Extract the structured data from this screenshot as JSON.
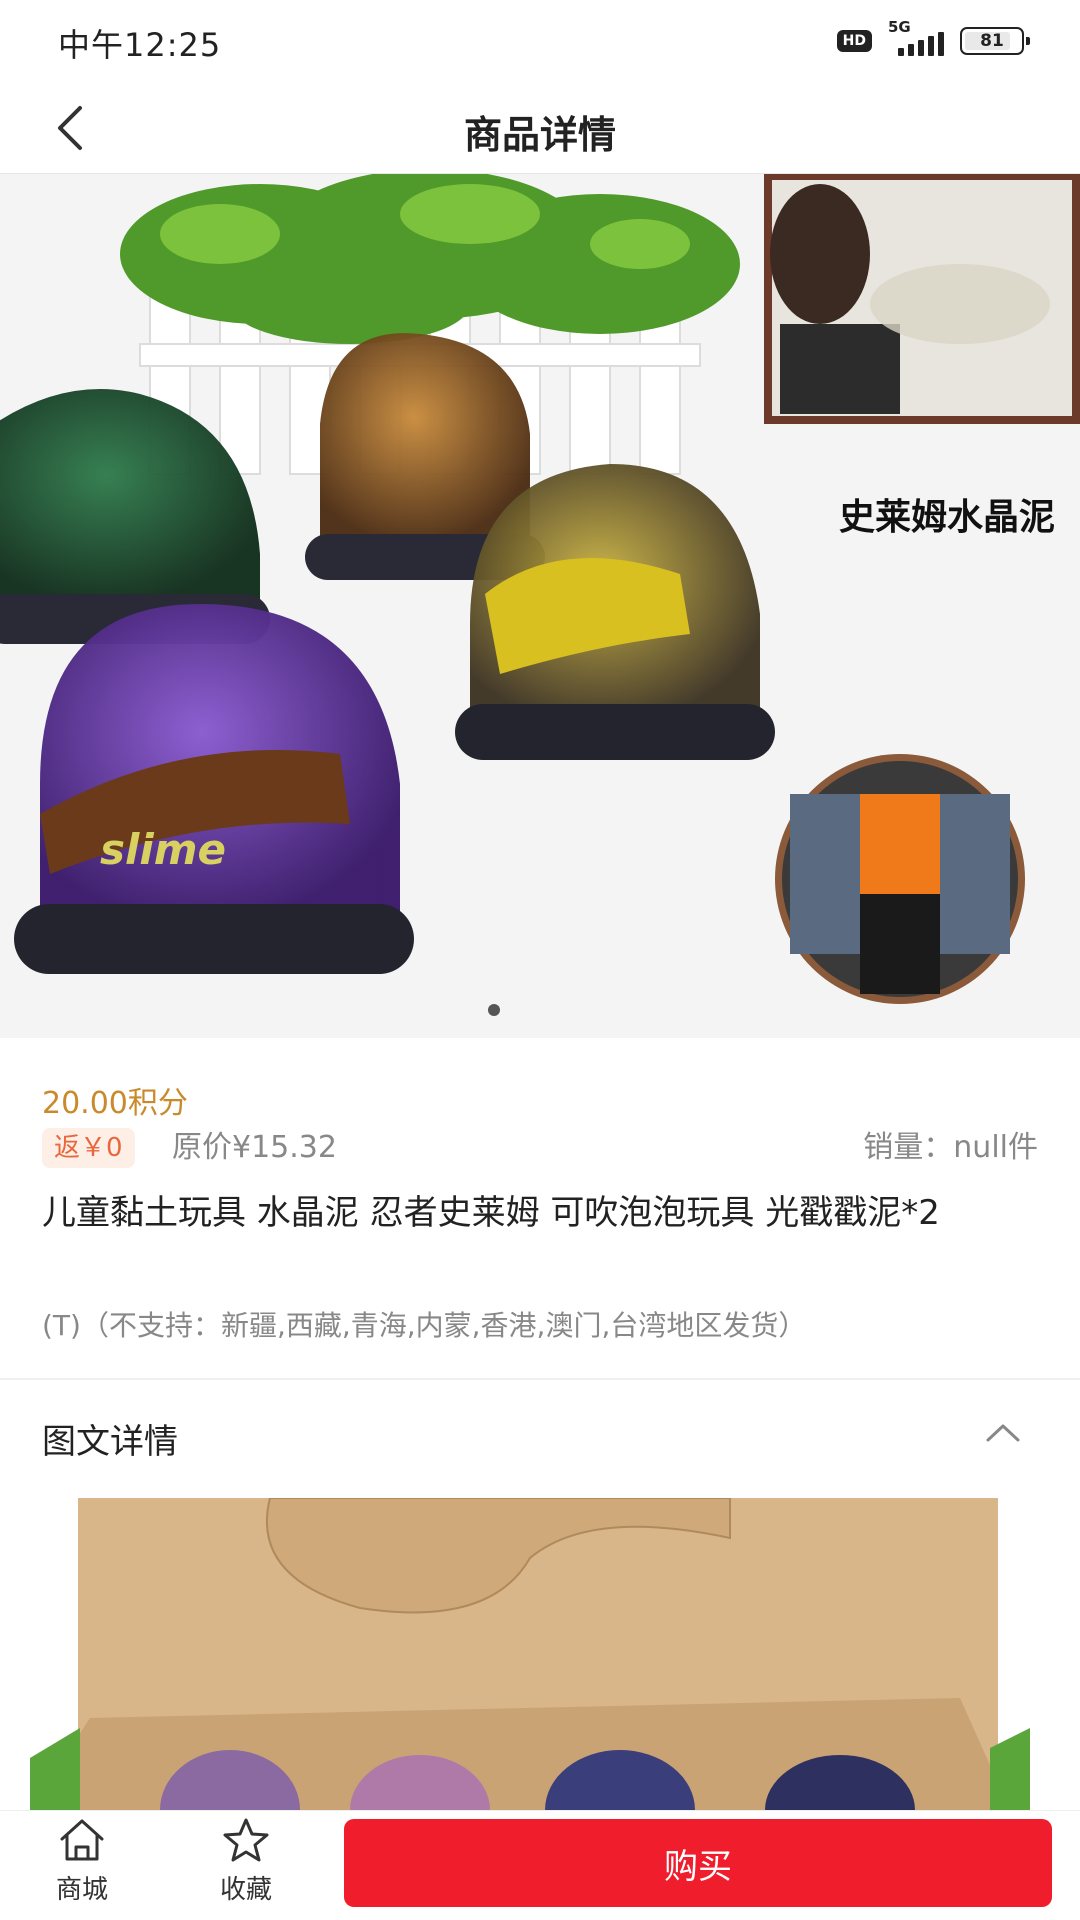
{
  "status_bar": {
    "time": "中午12:25",
    "hd": "HD",
    "network": "5G",
    "battery": "81"
  },
  "nav": {
    "title": "商品详情",
    "back_icon": "back-arrow-icon"
  },
  "product_image": {
    "overlay_text": "史莱姆水晶泥",
    "slime_label": "slime",
    "carousel_current": 1,
    "carousel_total": 1
  },
  "product": {
    "points_price": "20.00积分",
    "rebate": "返￥0",
    "original_price": "原价¥15.32",
    "sales_label": "销量：",
    "sales_value": "null件",
    "title": "儿童黏土玩具 水晶泥 忍者史莱姆 可吹泡泡玩具 光戳戳泥*2",
    "shipping_note": "(T)（不支持：新疆,西藏,青海,内蒙,香港,澳门,台湾地区发货）"
  },
  "details": {
    "title": "图文详情",
    "toggle_icon": "chevron-up-icon"
  },
  "bottom_bar": {
    "home_label": "商城",
    "home_icon": "home-icon",
    "fav_label": "收藏",
    "fav_icon": "star-icon",
    "buy_label": "购买"
  },
  "colors": {
    "points": "#c98a2b",
    "rebate_bg": "#fdeee6",
    "rebate_text": "#e8683c",
    "buy_button": "#f01d2c"
  }
}
